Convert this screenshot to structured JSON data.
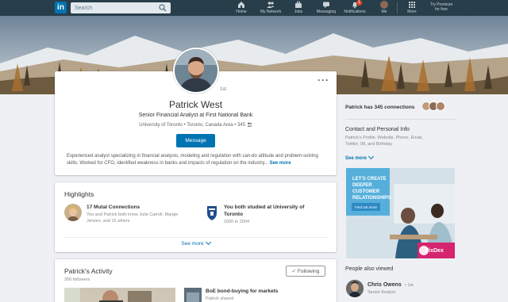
{
  "nav": {
    "logo": "in",
    "search_placeholder": "Search",
    "items": [
      {
        "label": "Home",
        "icon": "home-icon"
      },
      {
        "label": "My Network",
        "icon": "network-icon"
      },
      {
        "label": "Jobs",
        "icon": "briefcase-icon"
      },
      {
        "label": "Messaging",
        "icon": "messaging-icon"
      },
      {
        "label": "Notifications",
        "icon": "bell-icon",
        "badge": "1"
      },
      {
        "label": "Me",
        "icon": "me-avatar"
      },
      {
        "label": "More",
        "icon": "grid-icon"
      }
    ],
    "premium_line1": "Try Premium",
    "premium_line2": "for free"
  },
  "profile": {
    "name": "Patrick West",
    "degree": "1st",
    "headline": "Senior Financial Analyst at First National Bank",
    "school": "University of Toronto",
    "location": "Toronto, Canada Area",
    "connections_count": "345",
    "message_label": "Message",
    "summary": "Experienced analyst specializing in financial analysis, modeling and regulation with can-do attitude and problem-solving skills. Worked for CFO, identified weakness in banks and impacts of regulation on the industry...",
    "see_more": "See more"
  },
  "highlights": {
    "title": "Highlights",
    "items": [
      {
        "title": "17 Mutal Connections",
        "line1": "You and Patrick both know Julie Carroll, Margie",
        "line2": "Jensen, and 15 others"
      },
      {
        "title": "You both studied at University of",
        "line1": "Toronto",
        "line2": "2000 to 2004"
      }
    ],
    "see_more": "See more"
  },
  "activity": {
    "title": "Patrick's Activity",
    "followers": "350 followers",
    "following_label": "Following",
    "post_title": "BoE bond-buying for markets",
    "post_sub": "Patrick shared"
  },
  "sidebar": {
    "connections_text": "Patrick has 345 connections",
    "contact_title": "Contact and Personal Info",
    "contact_line1": "Patrick's Profile, Website, Phone, Email,",
    "contact_line2": "Twitter, IM, and Birthday",
    "see_more": "See more",
    "ad": {
      "headline": "LET'S CREATE DEEPER CUSTOMER RELATIONSHIPS.",
      "button": "Find out more",
      "brand": "FixDex"
    },
    "people_also_viewed": "People also viewed",
    "person": {
      "name": "Chris Owens",
      "degree": "1st",
      "title": "Senior Analyst"
    }
  },
  "colors": {
    "nav_bg": "#283e4a",
    "brand_blue": "#0073b1",
    "page_bg": "#eef0f3",
    "ad_magenta": "#d6246e"
  }
}
